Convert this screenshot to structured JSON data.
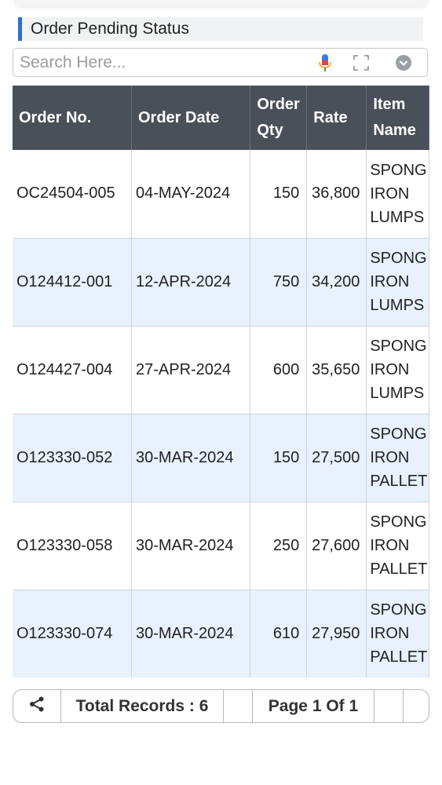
{
  "header": {
    "title": "Order Pending Status"
  },
  "search": {
    "placeholder": "Search Here..."
  },
  "table": {
    "headers": {
      "order_no": "Order No.",
      "order_date": "Order Date",
      "order_qty": "Order Qty",
      "rate": "Rate",
      "item_name": "Item Name"
    },
    "rows": [
      {
        "order_no": "OC24504-005",
        "order_date": "04-MAY-2024",
        "order_qty": "150",
        "rate": "36,800",
        "item_name": "SPONG IRON LUMPS"
      },
      {
        "order_no": "O124412-001",
        "order_date": "12-APR-2024",
        "order_qty": "750",
        "rate": "34,200",
        "item_name": "SPONG IRON LUMPS"
      },
      {
        "order_no": "O124427-004",
        "order_date": "27-APR-2024",
        "order_qty": "600",
        "rate": "35,650",
        "item_name": "SPONG IRON LUMPS"
      },
      {
        "order_no": "O123330-052",
        "order_date": "30-MAR-2024",
        "order_qty": "150",
        "rate": "27,500",
        "item_name": "SPONG IRON PALLET"
      },
      {
        "order_no": "O123330-058",
        "order_date": "30-MAR-2024",
        "order_qty": "250",
        "rate": "27,600",
        "item_name": "SPONG IRON PALLET"
      },
      {
        "order_no": "O123330-074",
        "order_date": "30-MAR-2024",
        "order_qty": "610",
        "rate": "27,950",
        "item_name": "SPONG IRON PALLET"
      }
    ]
  },
  "footer": {
    "total_records": "Total Records : 6",
    "page_info": "Page 1 Of 1"
  },
  "icons": {
    "mic": "mic-icon",
    "fullscreen": "fullscreen-icon",
    "dropdown": "chevron-down-icon",
    "share": "share-icon"
  },
  "colors": {
    "header_bg": "#4a5059",
    "accent": "#2d6fd6",
    "alt_row": "#e8f1fd"
  }
}
